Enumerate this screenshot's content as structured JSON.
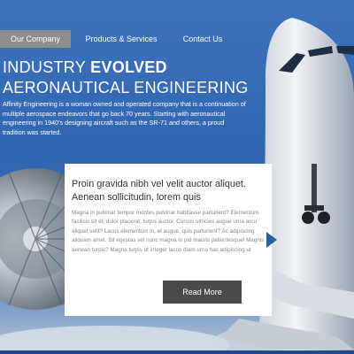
{
  "nav": {
    "items": [
      {
        "label": "Our Company",
        "active": true
      },
      {
        "label": "Products & Services",
        "active": false
      },
      {
        "label": "Contact Us",
        "active": false
      }
    ]
  },
  "hero": {
    "title_line1_light": "INDUSTRY",
    "title_line1_bold": "EVOLVED",
    "title_line2": "AERONAUTICAL ENGINEERING",
    "text": "Affinity Engineering is a woman owned and operated company that is a continuation of multiple aerospace endeavors that go back 70 years.  Starting with aeronautical engineering in 1940's designing aircraft such as the SR-71 and others, a proud tradition was started."
  },
  "card": {
    "title": "Proin gravida nibh vel velit auctor aliquet. Aenean sollicitudin, lorem quis",
    "body": "Magna in pulvinar tempor montes pulvinar habitasse parturient? Elementum facilisis sit et, dolor placerat, turpis auctor. Cursus ultricies augue urna arcu aliquet velit?  Lacus elementum in, et augue, quis parturient? Ac adipiscing aliquam amet. Sit egestas vel nunc magna in pid mauris pellentesque! Magnis aenean turpis? Magna turpis ut integer lacus diam urna hac adipiscing ut",
    "button_label": "Read More"
  },
  "colors": {
    "sky": "#2a5da8",
    "nav_active": "#8d8d8d",
    "button": "#4a4a4a"
  }
}
